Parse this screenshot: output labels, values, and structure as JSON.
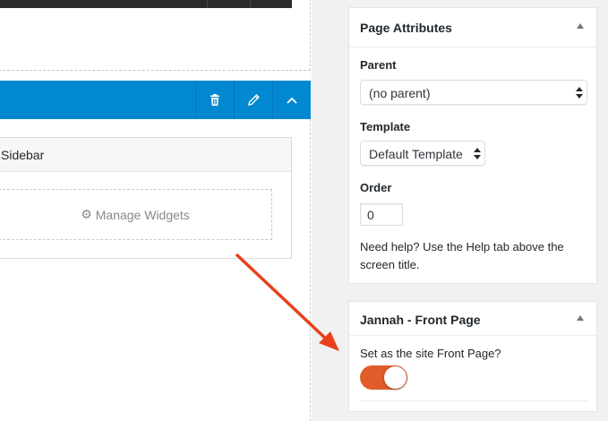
{
  "builder": {
    "sidebar_title": "Sidebar",
    "manage_widgets": "Manage Widgets",
    "blue_bar_color": "#0288d1",
    "icons": [
      "trash-icon",
      "pencil-icon",
      "chevron-up-icon",
      "gear-icon"
    ]
  },
  "page_attributes": {
    "title": "Page Attributes",
    "parent_label": "Parent",
    "parent_value": "(no parent)",
    "template_label": "Template",
    "template_value": "Default Template",
    "order_label": "Order",
    "order_value": "0",
    "help_text": "Need help? Use the Help tab above the screen title."
  },
  "front_page": {
    "title": "Jannah - Front Page",
    "question": "Set as the site Front Page?",
    "toggle_on": true,
    "toggle_color": "#e05d2a"
  },
  "annotation": {
    "arrow_color": "#e8401c"
  }
}
